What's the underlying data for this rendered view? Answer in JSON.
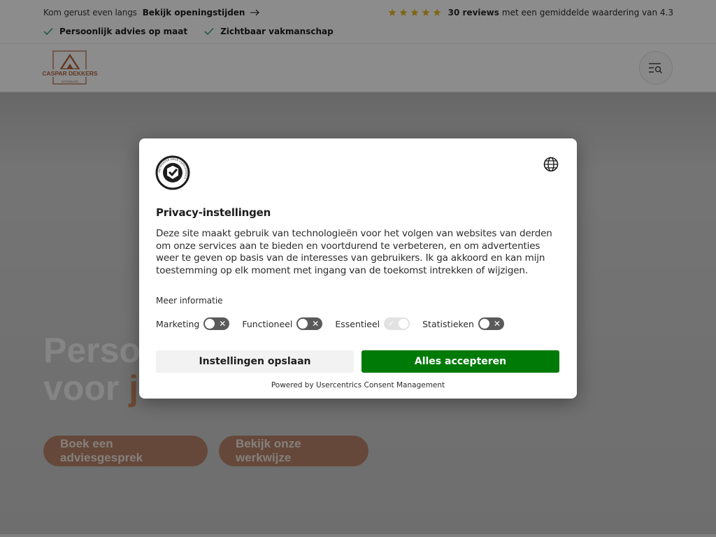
{
  "topbar": {
    "visit_text": "Kom gerust even langs",
    "opening_link": "Bekijk openingstijden",
    "reviews_count": "30 reviews",
    "reviews_text": "met een gemiddelde waardering van 4.3",
    "star_count": 5,
    "star_color": "#e8b923",
    "usps": [
      "Persoonlijk advies op maat",
      "Zichtbaar vakmanschap"
    ],
    "check_color": "#3aa66b"
  },
  "header": {
    "logo_text": "CASPAR DEKKERS",
    "logo_subtext": "INTERIEURS",
    "menu_icon": "menu-search-icon"
  },
  "hero": {
    "title_line1": "Perso",
    "title_line2_plain": "voor ",
    "title_line2_accent": "j",
    "button_primary": "Boek een adviesgesprek",
    "button_secondary": "Bekijk onze werkwijze"
  },
  "consent": {
    "logo_ring_text": "ONTWORPEN DOOR USERCENTRICS",
    "title": "Privacy-instellingen",
    "body": "Deze site maakt gebruik van technologieën voor het volgen van websites van derden om onze services aan te bieden en voortdurend te verbeteren, en om advertenties weer te geven op basis van de interesses van gebruikers. Ik ga akkoord en kan mijn toestemming op elk moment met ingang van de toekomst intrekken of wijzigen.",
    "more_info": "Meer informatie",
    "toggles": [
      {
        "label": "Marketing",
        "enabled": false,
        "locked": false
      },
      {
        "label": "Functioneel",
        "enabled": false,
        "locked": false
      },
      {
        "label": "Essentieel",
        "enabled": true,
        "locked": true
      },
      {
        "label": "Statistieken",
        "enabled": false,
        "locked": false
      }
    ],
    "save_button": "Instellingen opslaan",
    "accept_button": "Alles accepteren",
    "accept_color": "#007a07",
    "powered_by": "Powered by Usercentrics Consent Management"
  }
}
